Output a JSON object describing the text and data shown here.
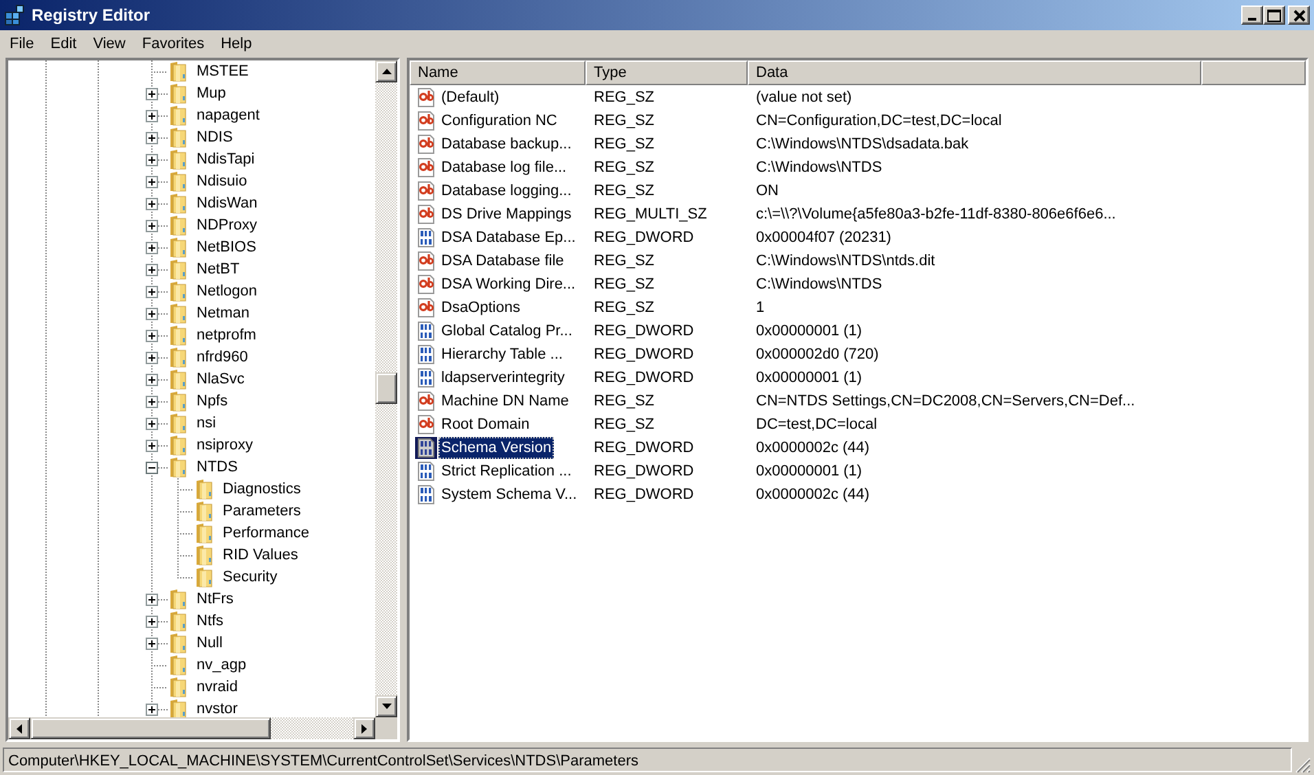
{
  "window": {
    "title": "Registry Editor"
  },
  "menu": [
    "File",
    "Edit",
    "View",
    "Favorites",
    "Help"
  ],
  "tree": {
    "items": [
      {
        "label": "MSTEE"
      },
      {
        "label": "Mup",
        "expanded": false
      },
      {
        "label": "napagent",
        "expanded": false
      },
      {
        "label": "NDIS",
        "expanded": false
      },
      {
        "label": "NdisTapi",
        "expanded": false
      },
      {
        "label": "Ndisuio",
        "expanded": false
      },
      {
        "label": "NdisWan",
        "expanded": false
      },
      {
        "label": "NDProxy",
        "expanded": false
      },
      {
        "label": "NetBIOS",
        "expanded": false
      },
      {
        "label": "NetBT",
        "expanded": false
      },
      {
        "label": "Netlogon",
        "expanded": false
      },
      {
        "label": "Netman",
        "expanded": false
      },
      {
        "label": "netprofm",
        "expanded": false
      },
      {
        "label": "nfrd960",
        "expanded": false
      },
      {
        "label": "NlaSvc",
        "expanded": false
      },
      {
        "label": "Npfs",
        "expanded": false
      },
      {
        "label": "nsi",
        "expanded": false
      },
      {
        "label": "nsiproxy",
        "expanded": false
      },
      {
        "label": "NTDS",
        "expanded": true,
        "children": [
          {
            "label": "Diagnostics"
          },
          {
            "label": "Parameters"
          },
          {
            "label": "Performance"
          },
          {
            "label": "RID Values"
          },
          {
            "label": "Security"
          }
        ]
      },
      {
        "label": "NtFrs",
        "expanded": false
      },
      {
        "label": "Ntfs",
        "expanded": false
      },
      {
        "label": "Null",
        "expanded": false
      },
      {
        "label": "nv_agp"
      },
      {
        "label": "nvraid"
      },
      {
        "label": "nvstor",
        "expanded": false
      }
    ]
  },
  "values": {
    "columns": [
      "Name",
      "Type",
      "Data"
    ],
    "rows": [
      {
        "kind": "string",
        "name": "(Default)",
        "type": "REG_SZ",
        "data": "(value not set)",
        "selected": false
      },
      {
        "kind": "string",
        "name": "Configuration NC",
        "type": "REG_SZ",
        "data": "CN=Configuration,DC=test,DC=local",
        "selected": false
      },
      {
        "kind": "string",
        "name": "Database backup...",
        "type": "REG_SZ",
        "data": "C:\\Windows\\NTDS\\dsadata.bak",
        "selected": false
      },
      {
        "kind": "string",
        "name": "Database log file...",
        "type": "REG_SZ",
        "data": "C:\\Windows\\NTDS",
        "selected": false
      },
      {
        "kind": "string",
        "name": "Database logging...",
        "type": "REG_SZ",
        "data": "ON",
        "selected": false
      },
      {
        "kind": "string",
        "name": "DS Drive Mappings",
        "type": "REG_MULTI_SZ",
        "data": "c:\\=\\\\?\\Volume{a5fe80a3-b2fe-11df-8380-806e6f6e6...",
        "selected": false
      },
      {
        "kind": "binary",
        "name": "DSA Database Ep...",
        "type": "REG_DWORD",
        "data": "0x00004f07 (20231)",
        "selected": false
      },
      {
        "kind": "string",
        "name": "DSA Database file",
        "type": "REG_SZ",
        "data": "C:\\Windows\\NTDS\\ntds.dit",
        "selected": false
      },
      {
        "kind": "string",
        "name": "DSA Working Dire...",
        "type": "REG_SZ",
        "data": "C:\\Windows\\NTDS",
        "selected": false
      },
      {
        "kind": "string",
        "name": "DsaOptions",
        "type": "REG_SZ",
        "data": "1",
        "selected": false
      },
      {
        "kind": "binary",
        "name": "Global Catalog Pr...",
        "type": "REG_DWORD",
        "data": "0x00000001 (1)",
        "selected": false
      },
      {
        "kind": "binary",
        "name": "Hierarchy Table ...",
        "type": "REG_DWORD",
        "data": "0x000002d0 (720)",
        "selected": false
      },
      {
        "kind": "binary",
        "name": "ldapserverintegrity",
        "type": "REG_DWORD",
        "data": "0x00000001 (1)",
        "selected": false
      },
      {
        "kind": "string",
        "name": "Machine DN Name",
        "type": "REG_SZ",
        "data": "CN=NTDS Settings,CN=DC2008,CN=Servers,CN=Def...",
        "selected": false
      },
      {
        "kind": "string",
        "name": "Root Domain",
        "type": "REG_SZ",
        "data": "DC=test,DC=local",
        "selected": false
      },
      {
        "kind": "binary",
        "name": "Schema Version",
        "type": "REG_DWORD",
        "data": "0x0000002c (44)",
        "selected": true
      },
      {
        "kind": "binary",
        "name": "Strict Replication ...",
        "type": "REG_DWORD",
        "data": "0x00000001 (1)",
        "selected": false
      },
      {
        "kind": "binary",
        "name": "System Schema V...",
        "type": "REG_DWORD",
        "data": "0x0000002c (44)",
        "selected": false
      }
    ]
  },
  "status_bar": "Computer\\HKEY_LOCAL_MACHINE\\SYSTEM\\CurrentControlSet\\Services\\NTDS\\Parameters"
}
